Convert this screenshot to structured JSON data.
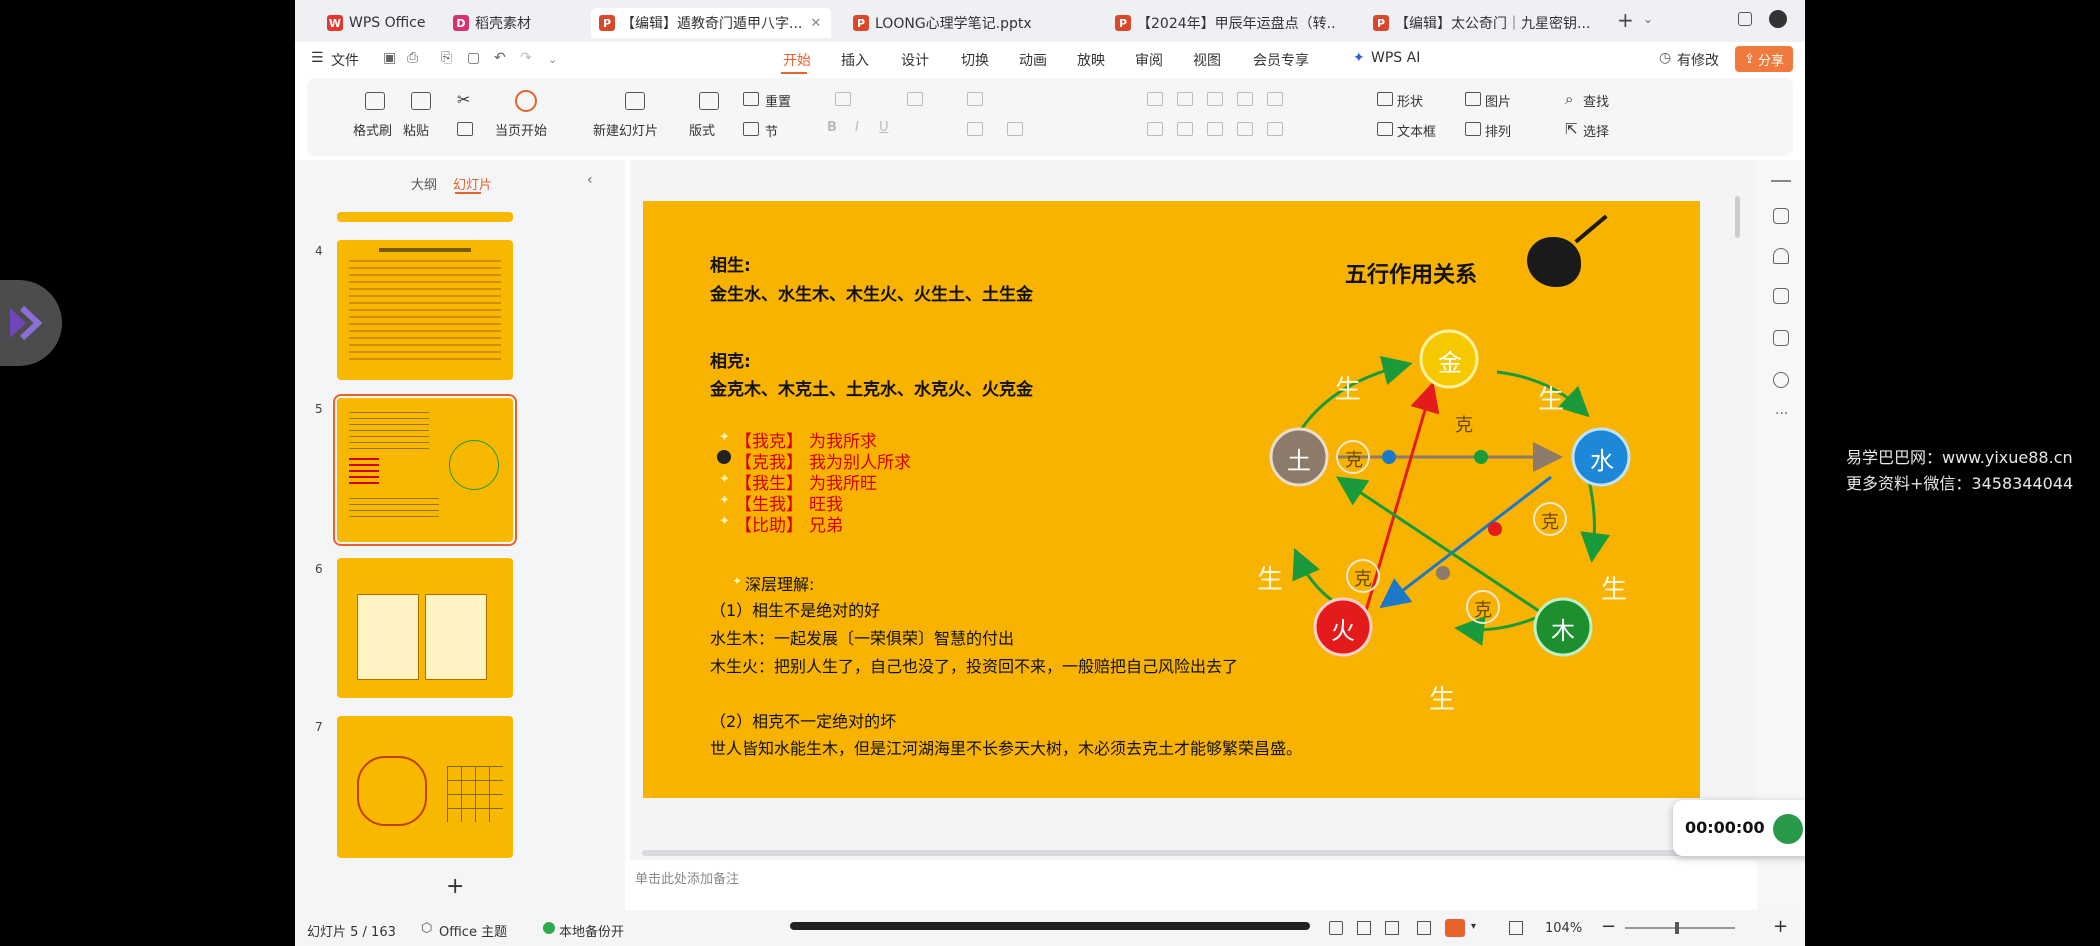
{
  "tabs": [
    {
      "label": "WPS Office",
      "icon": "wps-icon",
      "color": "#e8352e"
    },
    {
      "label": "稻壳素材",
      "icon": "docer-icon",
      "color": "#d6336c"
    },
    {
      "label": "【编辑】遁教奇门遁甲八字...",
      "icon": "ppt-icon",
      "color": "#d9482b",
      "active": true
    },
    {
      "label": "LOONG心理学笔记.pptx",
      "icon": "ppt-icon",
      "color": "#d9482b"
    },
    {
      "label": "【2024年】甲辰年运盘点（转...",
      "icon": "ppt-icon",
      "color": "#d9482b"
    },
    {
      "label": "【编辑】太公奇门｜九星密钥...",
      "icon": "ppt-icon",
      "color": "#d9482b"
    }
  ],
  "menu": {
    "file": "文件",
    "items": [
      "开始",
      "插入",
      "设计",
      "切换",
      "动画",
      "放映",
      "审阅",
      "视图",
      "会员专享"
    ],
    "ai": "WPS AI",
    "has_edit": "有修改",
    "share": "分享"
  },
  "ribbon": {
    "format_painter": "格式刷",
    "paste": "粘贴",
    "play_from_current": "当页开始",
    "new_slide": "新建幻灯片",
    "layout": "版式",
    "reset": "重置",
    "section": "节",
    "shape": "形状",
    "picture": "图片",
    "find": "查找",
    "textbox": "文本框",
    "arrange": "排列",
    "select": "选择"
  },
  "left_panel": {
    "tab_outline": "大纲",
    "tab_slides": "幻灯片",
    "thumb_numbers": [
      "4",
      "5",
      "6",
      "7"
    ],
    "add_label": "+"
  },
  "slide": {
    "title": "五行作用关系",
    "sheng_heading": "相生:",
    "sheng_line": "金生水、水生木、木生火、火生土、土生金",
    "ke_heading": "相克:",
    "ke_line": "金克木、木克土、土克水、水克火、火克金",
    "relations": [
      {
        "tag": "【我克】",
        "desc": "为我所求"
      },
      {
        "tag": "【克我】",
        "desc": "我为别人所求"
      },
      {
        "tag": "【我生】",
        "desc": "为我所旺"
      },
      {
        "tag": "【生我】",
        "desc": "旺我"
      },
      {
        "tag": "【比助】",
        "desc": "兄弟"
      }
    ],
    "deep_heading": "深层理解:",
    "point1": "（1）相生不是绝对的好",
    "point1_a": "水生木：一起发展〔一荣俱荣〕智慧的付出",
    "point1_b": "木生火：把别人生了，自己也没了，投资回不来，一般赔把自己风险出去了",
    "point2": "（2）相克不一定绝对的坏",
    "point2_a": "世人皆知水能生木，但是江河湖海里不长参天大树，木必须去克土才能够繁荣昌盛。",
    "elements": {
      "metal": "金",
      "water": "水",
      "wood": "木",
      "fire": "火",
      "earth": "土"
    },
    "sheng_char": "生",
    "ke_char": "克"
  },
  "notes_placeholder": "单击此处添加备注",
  "status": {
    "slide_info": "幻灯片 5 / 163",
    "theme": "Office 主题",
    "backup": "本地备份开",
    "zoom": "104%"
  },
  "timer": "00:00:00",
  "watermark": [
    "易学巴巴网：www.yixue88.cn",
    "更多资料+微信：3458344044"
  ],
  "colors": {
    "accent": "#e8622c",
    "slide_bg": "#f8b300",
    "metal": "#f5c800",
    "water": "#1e88d8",
    "wood": "#1d8f2e",
    "fire": "#e31b1b",
    "earth": "#8c7a6b",
    "arrow_green": "#1a9a3a"
  }
}
